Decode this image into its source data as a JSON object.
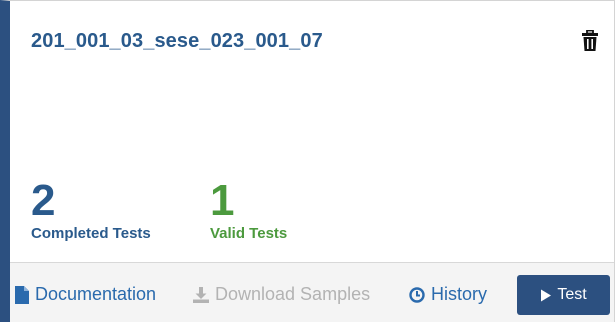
{
  "card": {
    "title": "201_001_03_sese_023_001_07",
    "delete_icon": "trash-icon"
  },
  "stats": {
    "completed": {
      "value": "2",
      "label": "Completed Tests"
    },
    "valid": {
      "value": "1",
      "label": "Valid Tests"
    }
  },
  "footer": {
    "documentation": {
      "label": "Documentation",
      "icon": "file-icon"
    },
    "download_samples": {
      "label": "Download Samples",
      "icon": "download-icon",
      "disabled": true
    },
    "history": {
      "label": "History",
      "icon": "clock-icon"
    },
    "test": {
      "label": "Test",
      "icon": "play-icon"
    }
  },
  "colors": {
    "accent": "#2c5080",
    "title": "#2a5a8c",
    "valid_green": "#4c9a3e",
    "link_blue": "#2a6aad",
    "disabled_gray": "#b3b3b3"
  }
}
